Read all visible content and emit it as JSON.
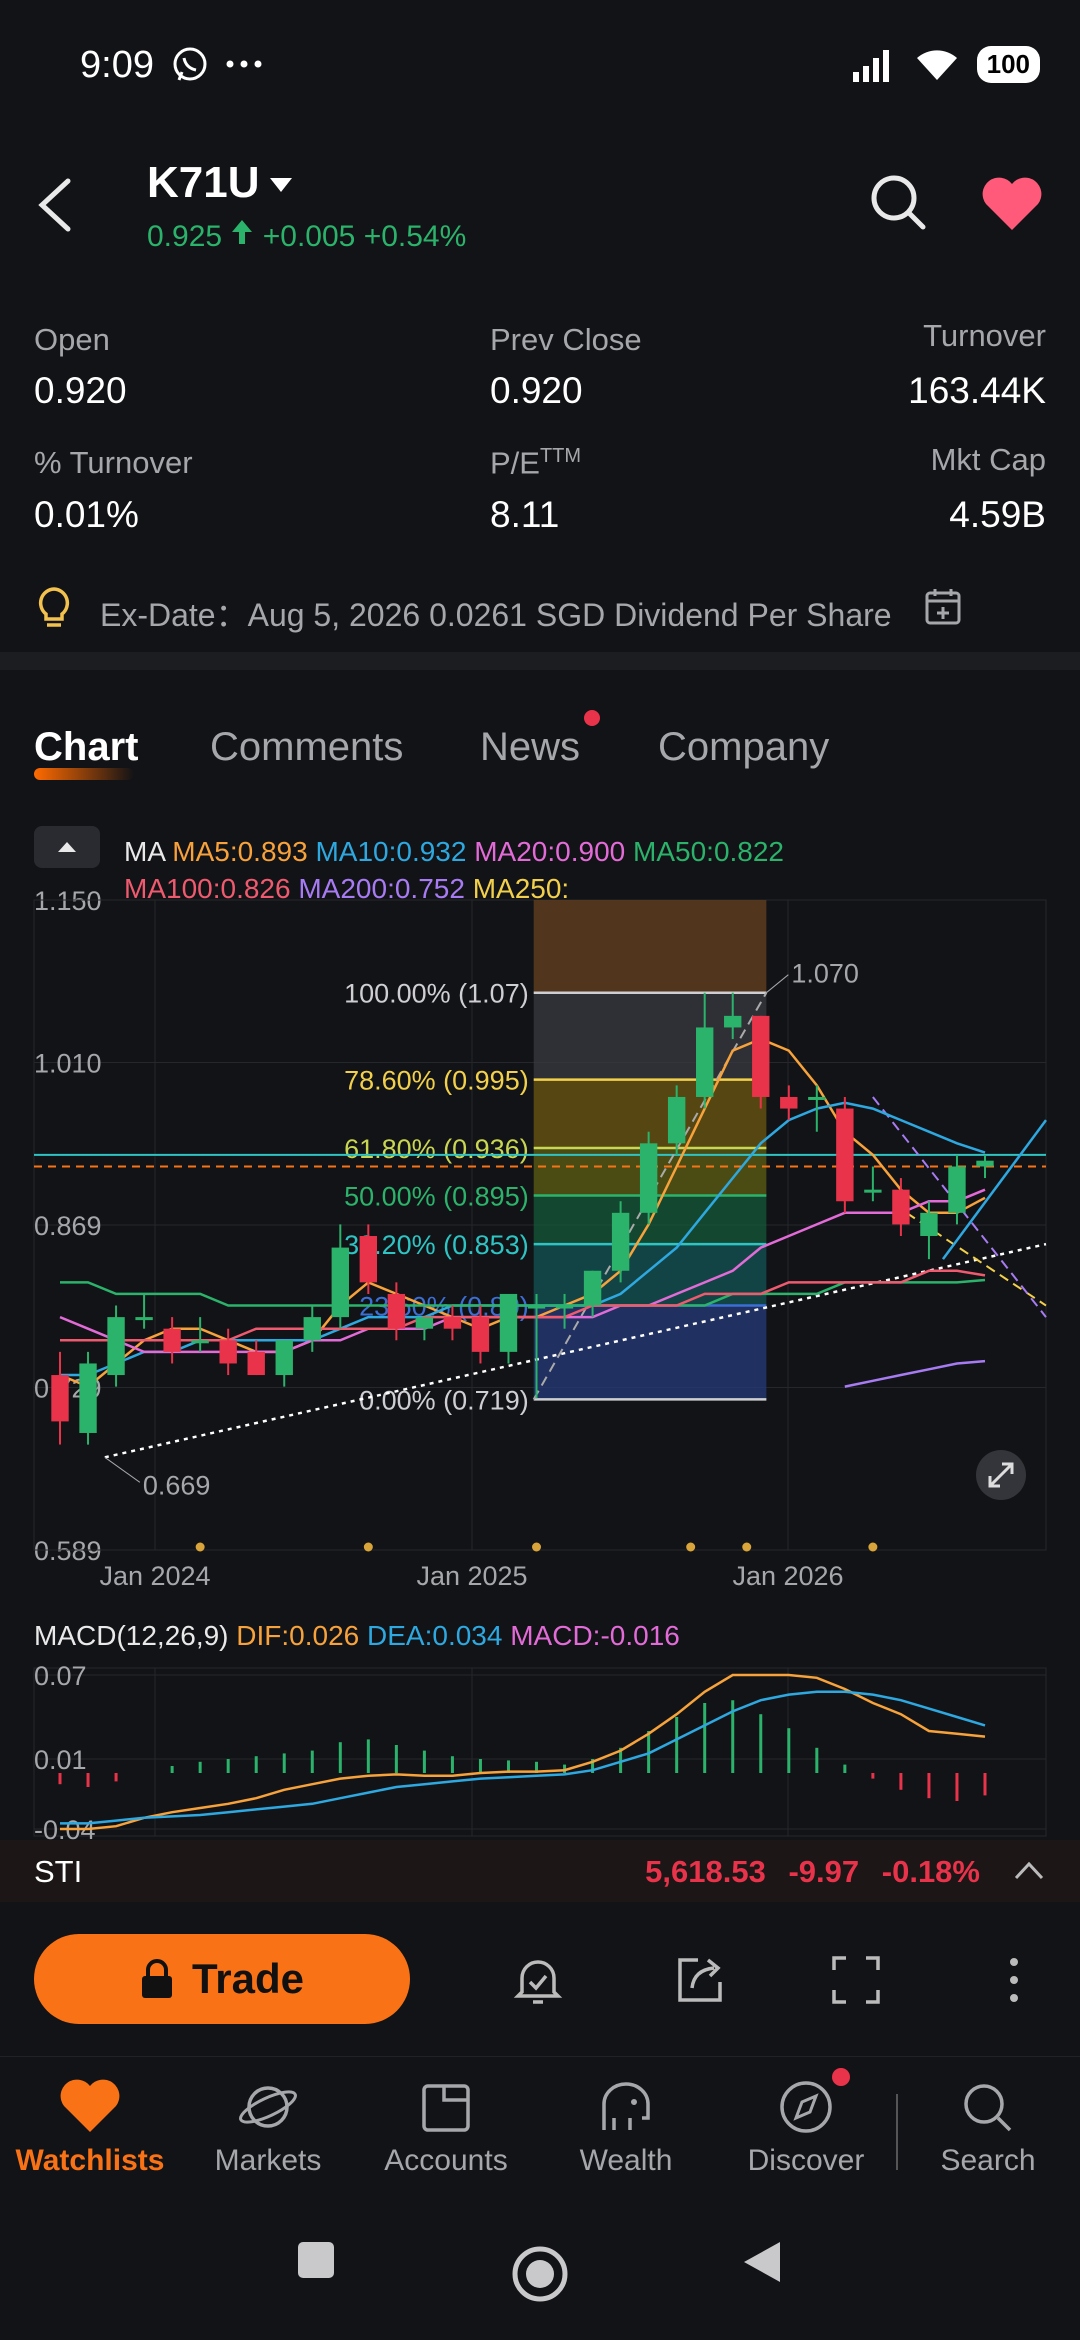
{
  "status_bar": {
    "time": "9:09",
    "battery": "100"
  },
  "header": {
    "symbol": "K71U",
    "price": "0.925",
    "change": "+0.005",
    "change_pct": "+0.54%"
  },
  "stats": [
    {
      "label": "Open",
      "value": "0.920"
    },
    {
      "label": "Prev Close",
      "value": "0.920"
    },
    {
      "label": "Turnover",
      "value": "163.44K"
    },
    {
      "label": "% Turnover",
      "value": "0.01%"
    },
    {
      "label": "P/E",
      "label_sup": "TTM",
      "value": "8.11"
    },
    {
      "label": "Mkt Cap",
      "value": "4.59B"
    }
  ],
  "exdate": "Ex-Date：Aug 5, 2026 0.0261 SGD Dividend Per Share",
  "tabs": [
    "Chart",
    "Comments",
    "News",
    "Company"
  ],
  "ma_legend": {
    "prefix": "MA",
    "items": [
      {
        "text": "MA5:0.893",
        "color": "#f7a23b"
      },
      {
        "text": "MA10:0.932",
        "color": "#2ea8e0"
      },
      {
        "text": "MA20:0.900",
        "color": "#e36bd8"
      },
      {
        "text": "MA50:0.822",
        "color": "#2bb36b"
      },
      {
        "text": "MA100:0.826",
        "color": "#ef5a6f"
      },
      {
        "text": "MA200:0.752",
        "color": "#a77bf3"
      },
      {
        "text": "MA250:",
        "color": "#f2d04b"
      }
    ]
  },
  "chart_data": [
    {
      "type": "candlestick",
      "y_ticks": [
        "1.150",
        "1.010",
        "0.869",
        "0.729",
        "0.589"
      ],
      "ylim": [
        0.589,
        1.15
      ],
      "x_ticks": [
        "Jan 2024",
        "Jan 2025",
        "Jan 2026"
      ],
      "fib_levels": [
        {
          "label": "100.00% (1.07)",
          "value": 1.07,
          "color": "#cfcfd3"
        },
        {
          "label": "78.60% (0.995)",
          "value": 0.995,
          "color": "#f2d04b"
        },
        {
          "label": "61.80% (0.936)",
          "value": 0.936,
          "color": "#c9d652"
        },
        {
          "label": "50.00% (0.895)",
          "value": 0.895,
          "color": "#2bb36b"
        },
        {
          "label": "38.20% (0.853)",
          "value": 0.853,
          "color": "#2ec4c4"
        },
        {
          "label": "23.60% (0.80)",
          "value": 0.8,
          "color": "#3b6fd6"
        },
        {
          "label": "0.00% (0.719)",
          "value": 0.719,
          "color": "#cfcfd3"
        }
      ],
      "annotations": [
        "1.070",
        "0.669"
      ],
      "reference_lines": {
        "prev_close": 0.92,
        "level": 0.93
      },
      "candles": [
        {
          "o": 0.74,
          "h": 0.76,
          "l": 0.68,
          "c": 0.7
        },
        {
          "o": 0.69,
          "h": 0.76,
          "l": 0.68,
          "c": 0.75
        },
        {
          "o": 0.74,
          "h": 0.8,
          "l": 0.73,
          "c": 0.79
        },
        {
          "o": 0.79,
          "h": 0.81,
          "l": 0.78,
          "c": 0.79
        },
        {
          "o": 0.78,
          "h": 0.79,
          "l": 0.75,
          "c": 0.76
        },
        {
          "o": 0.77,
          "h": 0.79,
          "l": 0.76,
          "c": 0.77
        },
        {
          "o": 0.77,
          "h": 0.78,
          "l": 0.74,
          "c": 0.75
        },
        {
          "o": 0.76,
          "h": 0.77,
          "l": 0.74,
          "c": 0.74
        },
        {
          "o": 0.74,
          "h": 0.77,
          "l": 0.73,
          "c": 0.77
        },
        {
          "o": 0.77,
          "h": 0.8,
          "l": 0.76,
          "c": 0.79
        },
        {
          "o": 0.79,
          "h": 0.87,
          "l": 0.78,
          "c": 0.85
        },
        {
          "o": 0.86,
          "h": 0.87,
          "l": 0.81,
          "c": 0.82
        },
        {
          "o": 0.81,
          "h": 0.82,
          "l": 0.77,
          "c": 0.78
        },
        {
          "o": 0.78,
          "h": 0.79,
          "l": 0.77,
          "c": 0.79
        },
        {
          "o": 0.79,
          "h": 0.8,
          "l": 0.77,
          "c": 0.78
        },
        {
          "o": 0.79,
          "h": 0.8,
          "l": 0.75,
          "c": 0.76
        },
        {
          "o": 0.76,
          "h": 0.81,
          "l": 0.75,
          "c": 0.81
        },
        {
          "o": 0.8,
          "h": 0.81,
          "l": 0.72,
          "c": 0.8
        },
        {
          "o": 0.8,
          "h": 0.81,
          "l": 0.78,
          "c": 0.8
        },
        {
          "o": 0.8,
          "h": 0.83,
          "l": 0.79,
          "c": 0.83
        },
        {
          "o": 0.83,
          "h": 0.89,
          "l": 0.82,
          "c": 0.88
        },
        {
          "o": 0.88,
          "h": 0.95,
          "l": 0.87,
          "c": 0.94
        },
        {
          "o": 0.94,
          "h": 0.99,
          "l": 0.93,
          "c": 0.98
        },
        {
          "o": 0.98,
          "h": 1.07,
          "l": 0.97,
          "c": 1.04
        },
        {
          "o": 1.04,
          "h": 1.07,
          "l": 1.03,
          "c": 1.05
        },
        {
          "o": 1.05,
          "h": 1.05,
          "l": 0.97,
          "c": 0.98
        },
        {
          "o": 0.98,
          "h": 0.99,
          "l": 0.96,
          "c": 0.97
        },
        {
          "o": 0.98,
          "h": 0.99,
          "l": 0.95,
          "c": 0.98
        },
        {
          "o": 0.97,
          "h": 0.98,
          "l": 0.88,
          "c": 0.89
        },
        {
          "o": 0.9,
          "h": 0.92,
          "l": 0.89,
          "c": 0.9
        },
        {
          "o": 0.9,
          "h": 0.91,
          "l": 0.86,
          "c": 0.87
        },
        {
          "o": 0.86,
          "h": 0.89,
          "l": 0.84,
          "c": 0.88
        },
        {
          "o": 0.88,
          "h": 0.93,
          "l": 0.87,
          "c": 0.92
        },
        {
          "o": 0.92,
          "h": 0.93,
          "l": 0.91,
          "c": 0.925
        }
      ],
      "ma_series": [
        {
          "name": "MA5",
          "color": "#f7a23b",
          "values": [
            0.74,
            0.73,
            0.75,
            0.77,
            0.78,
            0.78,
            0.77,
            0.76,
            0.76,
            0.77,
            0.8,
            0.82,
            0.81,
            0.8,
            0.79,
            0.78,
            0.79,
            0.79,
            0.8,
            0.81,
            0.83,
            0.87,
            0.92,
            0.97,
            1.02,
            1.03,
            1.02,
            0.99,
            0.95,
            0.93,
            0.9,
            0.88,
            0.88,
            0.893
          ]
        },
        {
          "name": "MA10",
          "color": "#2ea8e0",
          "values": [
            0.74,
            0.74,
            0.75,
            0.76,
            0.76,
            0.77,
            0.77,
            0.77,
            0.77,
            0.77,
            0.78,
            0.79,
            0.79,
            0.79,
            0.8,
            0.8,
            0.8,
            0.8,
            0.8,
            0.8,
            0.81,
            0.83,
            0.85,
            0.88,
            0.91,
            0.94,
            0.96,
            0.97,
            0.975,
            0.97,
            0.96,
            0.95,
            0.94,
            0.932
          ]
        },
        {
          "name": "MA20",
          "color": "#e36bd8",
          "values": [
            0.79,
            0.78,
            0.77,
            0.76,
            0.76,
            0.76,
            0.76,
            0.76,
            0.76,
            0.77,
            0.77,
            0.78,
            0.78,
            0.78,
            0.79,
            0.79,
            0.79,
            0.79,
            0.79,
            0.79,
            0.8,
            0.8,
            0.81,
            0.82,
            0.83,
            0.85,
            0.86,
            0.87,
            0.88,
            0.88,
            0.88,
            0.89,
            0.89,
            0.9
          ]
        },
        {
          "name": "MA50",
          "color": "#2bb36b",
          "values": [
            0.82,
            0.82,
            0.81,
            0.81,
            0.81,
            0.81,
            0.8,
            0.8,
            0.8,
            0.8,
            0.8,
            0.8,
            0.8,
            0.8,
            0.8,
            0.8,
            0.8,
            0.8,
            0.8,
            0.8,
            0.8,
            0.8,
            0.8,
            0.8,
            0.81,
            0.81,
            0.81,
            0.81,
            0.82,
            0.82,
            0.82,
            0.82,
            0.82,
            0.822
          ]
        },
        {
          "name": "MA100",
          "color": "#ef5a6f",
          "values": [
            0.77,
            0.77,
            0.77,
            0.77,
            0.77,
            0.77,
            0.77,
            0.78,
            0.78,
            0.78,
            0.78,
            0.78,
            0.78,
            0.79,
            0.79,
            0.79,
            0.79,
            0.79,
            0.79,
            0.8,
            0.8,
            0.8,
            0.8,
            0.81,
            0.81,
            0.81,
            0.82,
            0.82,
            0.82,
            0.82,
            0.82,
            0.83,
            0.83,
            0.826
          ]
        },
        {
          "name": "MA200",
          "color": "#a77bf3",
          "values": [
            null,
            null,
            null,
            null,
            null,
            null,
            null,
            null,
            null,
            null,
            null,
            null,
            null,
            null,
            null,
            null,
            null,
            null,
            null,
            null,
            null,
            null,
            null,
            null,
            null,
            null,
            null,
            null,
            0.73,
            0.735,
            0.74,
            0.745,
            0.75,
            0.752
          ]
        }
      ]
    },
    {
      "type": "macd",
      "title": "MACD(12,26,9)",
      "dif_label": "DIF:0.026",
      "dea_label": "DEA:0.034",
      "macd_label": "MACD:-0.016",
      "y_ticks": [
        "0.07",
        "0.01",
        "-0.04"
      ],
      "ylim": [
        -0.045,
        0.075
      ],
      "dif": [
        -0.04,
        -0.04,
        -0.038,
        -0.032,
        -0.028,
        -0.025,
        -0.022,
        -0.018,
        -0.012,
        -0.008,
        -0.004,
        -0.002,
        -0.001,
        -0.002,
        -0.002,
        0.0,
        0.001,
        0.001,
        0.002,
        0.008,
        0.016,
        0.028,
        0.042,
        0.058,
        0.07,
        0.07,
        0.07,
        0.068,
        0.06,
        0.05,
        0.042,
        0.03,
        0.028,
        0.026
      ],
      "dea": [
        -0.036,
        -0.036,
        -0.034,
        -0.032,
        -0.031,
        -0.03,
        -0.028,
        -0.026,
        -0.024,
        -0.022,
        -0.018,
        -0.014,
        -0.01,
        -0.008,
        -0.006,
        -0.004,
        -0.003,
        -0.002,
        -0.001,
        0.002,
        0.008,
        0.014,
        0.024,
        0.034,
        0.044,
        0.052,
        0.056,
        0.058,
        0.058,
        0.056,
        0.052,
        0.046,
        0.04,
        0.034
      ],
      "hist": [
        -0.008,
        -0.01,
        -0.006,
        0.0,
        0.005,
        0.008,
        0.01,
        0.012,
        0.014,
        0.016,
        0.022,
        0.024,
        0.02,
        0.016,
        0.012,
        0.01,
        0.009,
        0.008,
        0.006,
        0.01,
        0.018,
        0.03,
        0.04,
        0.05,
        0.052,
        0.042,
        0.032,
        0.018,
        0.006,
        -0.004,
        -0.012,
        -0.018,
        -0.02,
        -0.016
      ]
    }
  ],
  "sti": {
    "name": "STI",
    "value": "5,618.53",
    "change": "-9.97",
    "change_pct": "-0.18%"
  },
  "trade_label": "Trade",
  "nav": [
    "Watchlists",
    "Markets",
    "Accounts",
    "Wealth",
    "Discover",
    "Search"
  ],
  "colors": {
    "up": "#2bb36b",
    "down": "#e8334a",
    "accent": "#f97316",
    "bg": "#121316"
  }
}
